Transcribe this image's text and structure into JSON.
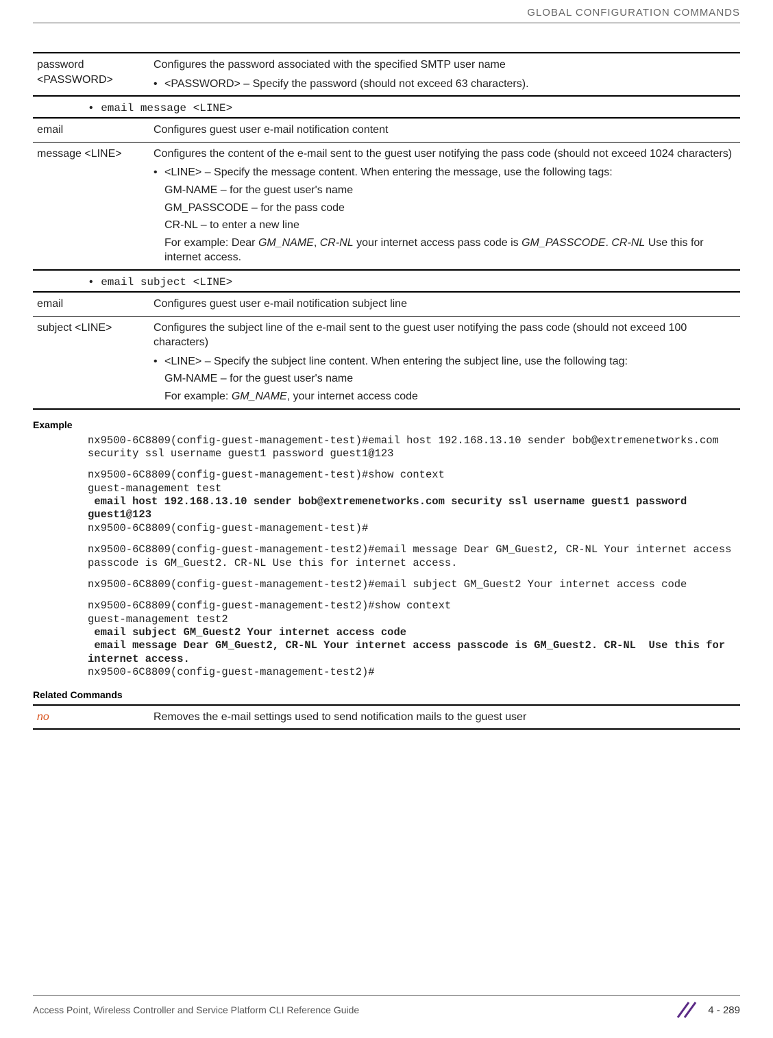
{
  "header": {
    "running_head": "GLOBAL CONFIGURATION COMMANDS"
  },
  "table1": {
    "param": "password <PASSWORD>",
    "desc_line": "Configures the password associated with the specified SMTP user name",
    "bullet": "<PASSWORD> – Specify the password (should not exceed 63 characters)."
  },
  "code1": "• email message <LINE>",
  "table2": {
    "r1_param": "email",
    "r1_desc": "Configures guest user e-mail notification content",
    "r2_param": "message <LINE>",
    "r2_desc": "Configures the content of the e-mail sent to the guest user notifying the pass code (should not exceed 1024 characters)",
    "r2_bullet": "<LINE> – Specify the message content. When entering the message, use the following tags:",
    "r2_sub1": "GM-NAME – for the guest user's name",
    "r2_sub2": "GM_PASSCODE – for the pass code",
    "r2_sub3": "CR-NL – to enter a new line",
    "r2_ex_a": "For example: Dear ",
    "r2_ex_b": "GM_NAME",
    "r2_ex_c": ", ",
    "r2_ex_d": "CR-NL",
    "r2_ex_e": " your internet access pass code is ",
    "r2_ex_f": "GM_PASSCODE",
    "r2_ex_g": ". ",
    "r2_ex_h": "CR-NL",
    "r2_ex_i": " Use this for internet access."
  },
  "code2": "• email subject <LINE>",
  "table3": {
    "r1_param": "email",
    "r1_desc": "Configures guest user e-mail notification subject line",
    "r2_param": "subject <LINE>",
    "r2_desc": "Configures the subject line of the e-mail sent to the guest user notifying the pass code (should not exceed 100 characters)",
    "r2_bullet": "<LINE> – Specify the subject line content. When entering the subject line, use the following tag:",
    "r2_sub1": "GM-NAME – for the guest user's name",
    "r2_ex_a": "For example: ",
    "r2_ex_b": "GM_NAME",
    "r2_ex_c": ", your internet access code"
  },
  "labels": {
    "example": "Example",
    "related": "Related Commands"
  },
  "cli": {
    "l1": "nx9500-6C8809(config-guest-management-test)#email host 192.168.13.10 sender bob@extremenetworks.com security ssl username guest1 password guest1@123",
    "l2": "nx9500-6C8809(config-guest-management-test)#show context",
    "l3": "guest-management test",
    "l4": " email host 192.168.13.10 sender bob@extremenetworks.com security ssl username guest1 password guest1@123",
    "l5": "nx9500-6C8809(config-guest-management-test)#",
    "l6": "nx9500-6C8809(config-guest-management-test2)#email message Dear GM_Guest2, CR-NL Your internet access passcode is GM_Guest2. CR-NL Use this for internet access.",
    "l7": "nx9500-6C8809(config-guest-management-test2)#email subject GM_Guest2 Your internet access code",
    "l8": "nx9500-6C8809(config-guest-management-test2)#show context",
    "l9": "guest-management test2",
    "l10": " email subject GM_Guest2 Your internet access code",
    "l11": " email message Dear GM_Guest2, CR-NL Your internet access passcode is GM_Guest2. CR-NL  Use this for internet access.",
    "l12": "nx9500-6C8809(config-guest-management-test2)#"
  },
  "table4": {
    "param": "no",
    "desc": "Removes the e-mail settings used to send notification mails to the guest user"
  },
  "footer": {
    "left": "Access Point, Wireless Controller and Service Platform CLI Reference Guide",
    "page": "4 - 289"
  }
}
